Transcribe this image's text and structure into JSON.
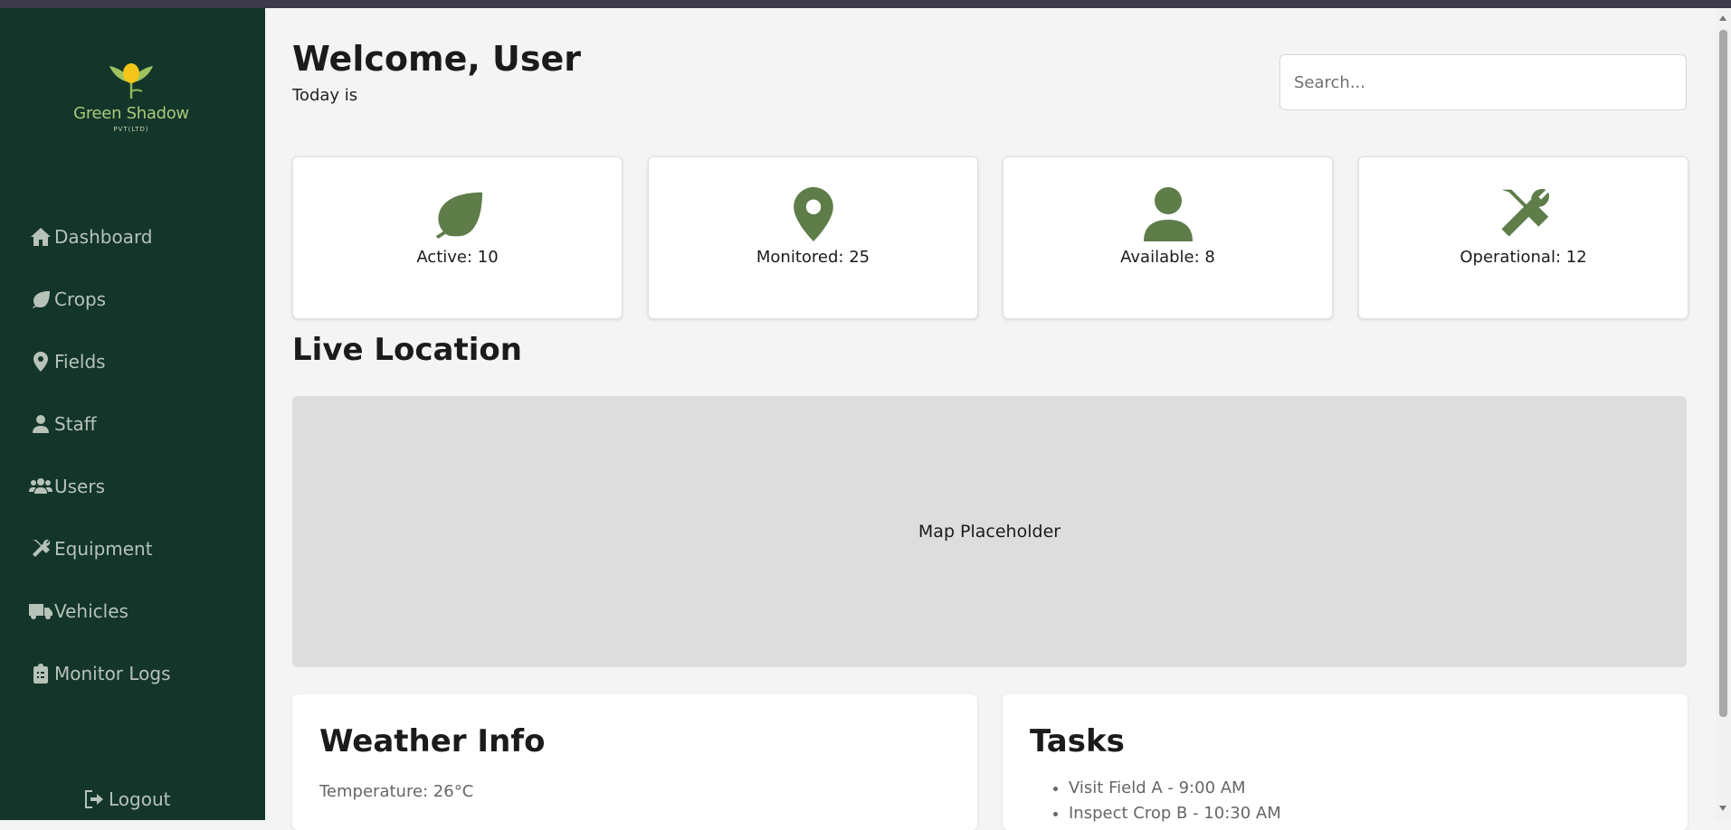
{
  "brand": {
    "name": "Green Shadow",
    "subtitle": "PVT(LTD)"
  },
  "sidebar": {
    "items": [
      {
        "label": "Dashboard",
        "icon": "home-icon"
      },
      {
        "label": "Crops",
        "icon": "leaf-icon"
      },
      {
        "label": "Fields",
        "icon": "map-pin-icon"
      },
      {
        "label": "Staff",
        "icon": "user-icon"
      },
      {
        "label": "Users",
        "icon": "users-icon"
      },
      {
        "label": "Equipment",
        "icon": "tools-icon"
      },
      {
        "label": "Vehicles",
        "icon": "truck-icon"
      },
      {
        "label": "Monitor Logs",
        "icon": "clipboard-icon"
      }
    ],
    "logout": "Logout"
  },
  "header": {
    "welcome": "Welcome, User",
    "today": "Today is",
    "search_placeholder": "Search..."
  },
  "cards": [
    {
      "label": "Active: 10",
      "icon": "leaf-icon"
    },
    {
      "label": "Monitored: 25",
      "icon": "map-pin-icon"
    },
    {
      "label": "Available: 8",
      "icon": "user-icon"
    },
    {
      "label": "Operational: 12",
      "icon": "tools-icon"
    }
  ],
  "live_location": {
    "title": "Live Location",
    "map_text": "Map Placeholder"
  },
  "weather": {
    "title": "Weather Info",
    "temperature": "Temperature: 26°C"
  },
  "tasks": {
    "title": "Tasks",
    "items": [
      "Visit Field A - 9:00 AM",
      "Inspect Crop B - 10:30 AM"
    ]
  },
  "colors": {
    "sidebar_bg": "#13352a",
    "accent": "#5e7d49",
    "page_bg": "#f4f4f4"
  }
}
